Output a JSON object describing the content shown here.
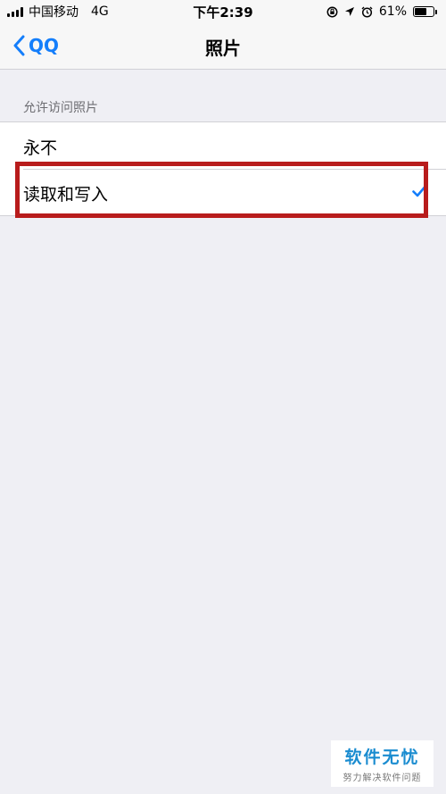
{
  "status_bar": {
    "carrier": "中国移动",
    "network": "4G",
    "time": "下午2:39",
    "battery_label": "61%",
    "battery_level": 0.61
  },
  "nav": {
    "back_label": "QQ",
    "title": "照片",
    "accent_color": "#147efb"
  },
  "section": {
    "header": "允许访问照片",
    "options": [
      {
        "label": "永不",
        "selected": false
      },
      {
        "label": "读取和写入",
        "selected": true
      }
    ]
  },
  "annotation": {
    "color": "#b81c1c"
  },
  "watermark": {
    "title": "软件无忧",
    "subtitle": "努力解决软件问题"
  }
}
